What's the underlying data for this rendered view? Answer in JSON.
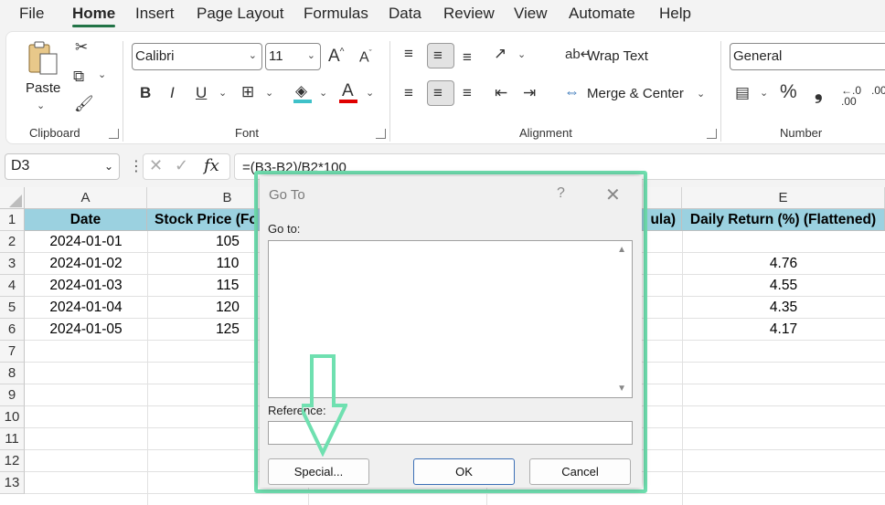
{
  "menu": {
    "file": "File",
    "home": "Home",
    "insert": "Insert",
    "page_layout": "Page Layout",
    "formulas": "Formulas",
    "data": "Data",
    "review": "Review",
    "view": "View",
    "automate": "Automate",
    "help": "Help"
  },
  "ribbon": {
    "clipboard": {
      "paste": "Paste",
      "label": "Clipboard"
    },
    "font": {
      "name": "Calibri",
      "size": "11",
      "bold": "B",
      "italic": "I",
      "underline": "U",
      "label": "Font"
    },
    "alignment": {
      "wrap_text": "Wrap Text",
      "merge_center": "Merge & Center",
      "label": "Alignment"
    },
    "number": {
      "format": "General",
      "label": "Number"
    }
  },
  "formula_bar": {
    "name_box": "D3",
    "fx": "fx",
    "formula": "=(B3-B2)/B2*100"
  },
  "grid": {
    "columns": [
      "A",
      "B",
      "E"
    ],
    "rows": [
      "1",
      "2",
      "3",
      "4",
      "5",
      "6",
      "7",
      "8",
      "9",
      "10",
      "11",
      "12",
      "13"
    ],
    "headers": {
      "a": "Date",
      "b": "Stock Price (Fo",
      "d": "ula)",
      "e": "Daily Return (%) (Flattened)"
    },
    "data": [
      {
        "date": "2024-01-01",
        "price": "105",
        "ret": ""
      },
      {
        "date": "2024-01-02",
        "price": "110",
        "ret": "4.76"
      },
      {
        "date": "2024-01-03",
        "price": "115",
        "ret": "4.55"
      },
      {
        "date": "2024-01-04",
        "price": "120",
        "ret": "4.35"
      },
      {
        "date": "2024-01-05",
        "price": "125",
        "ret": "4.17"
      }
    ]
  },
  "dialog": {
    "title": "Go To",
    "help": "?",
    "goto_label": "Go to:",
    "reference_label": "Reference:",
    "special_button": "Special...",
    "ok_button": "OK",
    "cancel_button": "Cancel"
  },
  "colors": {
    "header_fill": "#9bd1e0",
    "highlight": "#6fe0b0",
    "accent": "#217346"
  }
}
